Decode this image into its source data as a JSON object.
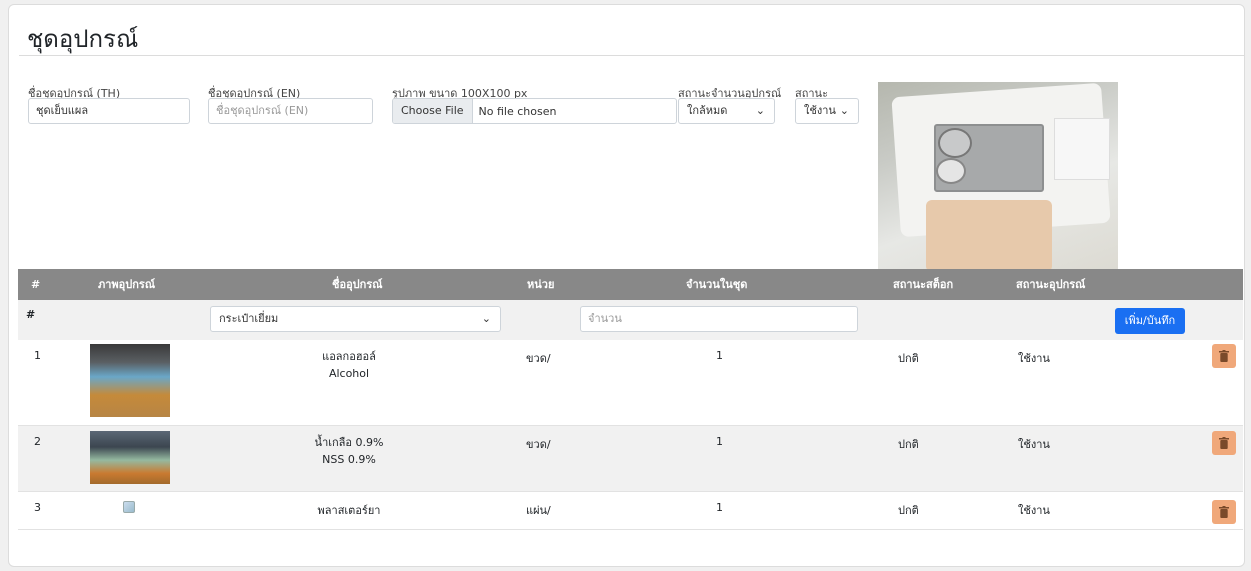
{
  "page": {
    "title": "ชุดอุปกรณ์"
  },
  "form": {
    "name_th_label": "ชื่อชุดอุปกรณ์ (TH)",
    "name_th_value": "ชุดเย็บแผล",
    "name_en_label": "ชื่อชุดอุปกรณ์ (EN)",
    "name_en_placeholder": "ชื่อชุดอุปกรณ์ (EN)",
    "image_label": "รูปภาพ ขนาด 100X100 px",
    "file_button": "Choose File",
    "file_status": "No file chosen",
    "qty_status_label": "สถานะจำนวนอุปกรณ์",
    "qty_status_value": "ใกล้หมด",
    "status_label": "สถานะ",
    "status_value": "ใช้งาน"
  },
  "table": {
    "headers": [
      "#",
      "ภาพอุปกรณ์",
      "ชื่ออุปกรณ์",
      "หน่วย",
      "จำนวนในชุด",
      "สถานะสต็อก",
      "สถานะอุปกรณ์"
    ],
    "add_row": {
      "hash": "#",
      "equipment_select": "กระเป๋าเยี่ยม",
      "qty_placeholder": "จำนวน",
      "save_button": "เพิ่ม/บันทึก"
    },
    "rows": [
      {
        "no": "1",
        "name_th": "แอลกอฮอล์",
        "name_en": "Alcohol",
        "unit": "ขวด/",
        "qty": "1",
        "stock": "ปกติ",
        "status": "ใช้งาน"
      },
      {
        "no": "2",
        "name_th": "น้ำเกลือ 0.9%",
        "name_en": "NSS 0.9%",
        "unit": "ขวด/",
        "qty": "1",
        "stock": "ปกติ",
        "status": "ใช้งาน"
      },
      {
        "no": "3",
        "name_th": "พลาสเตอร์ยา",
        "name_en": "",
        "unit": "แผ่น/",
        "qty": "1",
        "stock": "ปกติ",
        "status": "ใช้งาน"
      }
    ]
  },
  "icons": {
    "delete": "trash-icon",
    "dropdown": "chevron-down-icon"
  },
  "colors": {
    "header_bg": "#888888",
    "primary": "#1a6ff2",
    "delete_btn": "#f0a87a"
  }
}
